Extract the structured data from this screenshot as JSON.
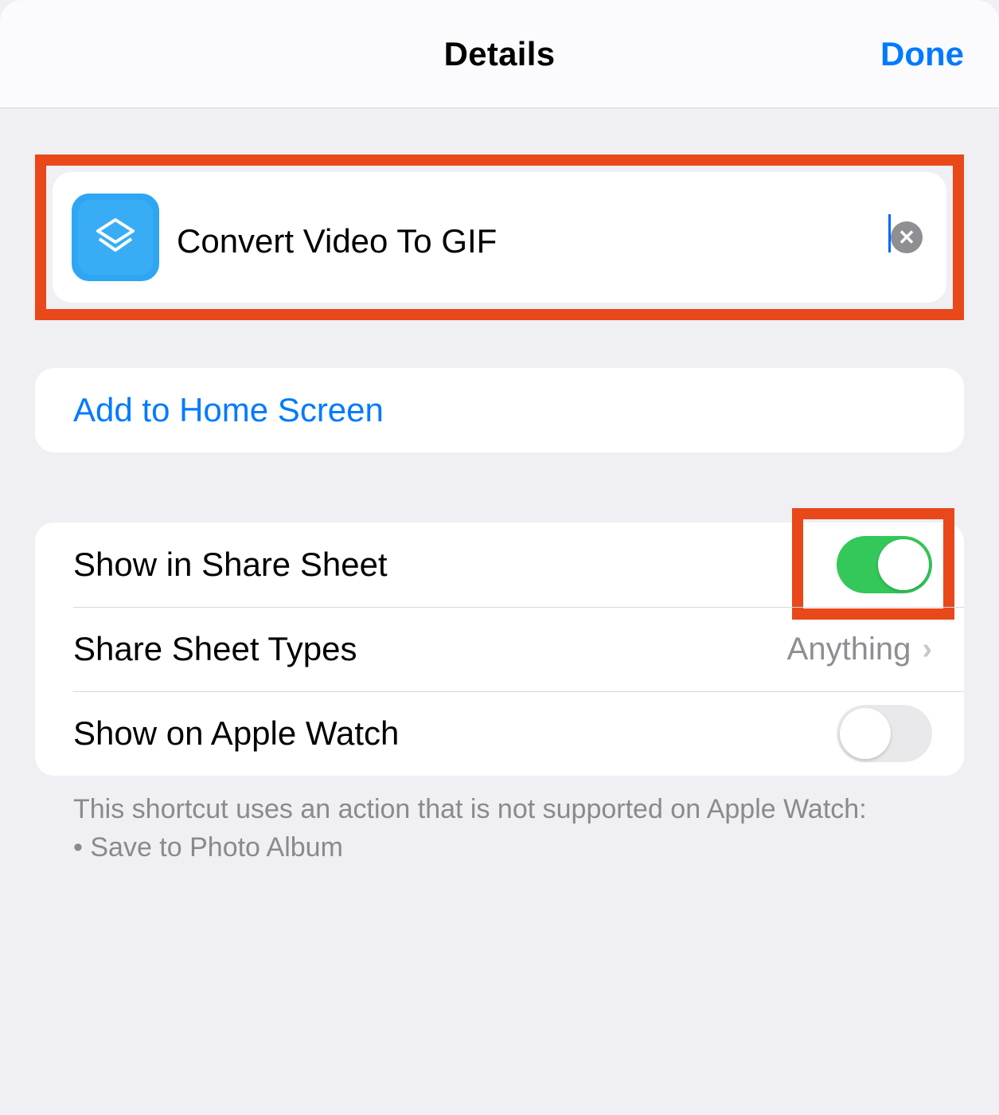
{
  "header": {
    "title": "Details",
    "done": "Done"
  },
  "shortcut": {
    "name": "Convert Video To GIF",
    "icon_name": "shortcuts-icon"
  },
  "actions": {
    "add_to_home": "Add to Home Screen"
  },
  "settings": {
    "share_sheet": {
      "label": "Show in Share Sheet",
      "enabled": true
    },
    "share_types": {
      "label": "Share Sheet Types",
      "value": "Anything"
    },
    "apple_watch": {
      "label": "Show on Apple Watch",
      "enabled": false
    }
  },
  "footer": {
    "note_line1": "This shortcut uses an action that is not supported on Apple Watch:",
    "unsupported_actions": [
      "Save to Photo Album"
    ]
  },
  "colors": {
    "accent": "#007aff",
    "toggle_on": "#34c759",
    "highlight": "#e8481a",
    "icon_bg": "#38adf5"
  }
}
